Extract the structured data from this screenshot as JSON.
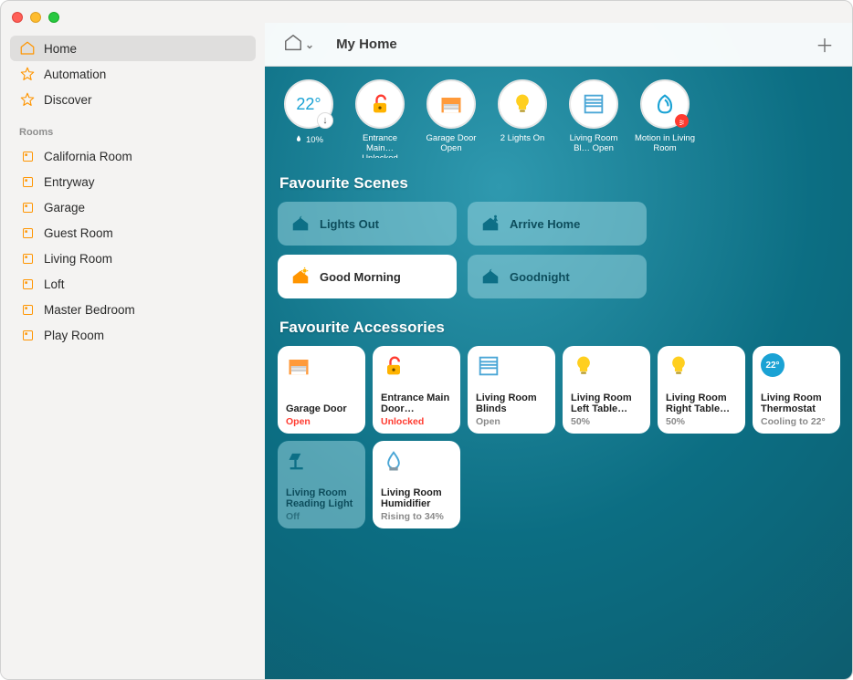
{
  "colors": {
    "accent_orange": "#ff9500",
    "accent_blue": "#1aa2d4",
    "state_red": "#ff3b30"
  },
  "window_title": "My Home",
  "sidebar": {
    "nav": [
      {
        "label": "Home",
        "icon": "home-icon",
        "selected": true
      },
      {
        "label": "Automation",
        "icon": "automation-icon",
        "selected": false
      },
      {
        "label": "Discover",
        "icon": "discover-icon",
        "selected": false
      }
    ],
    "rooms_header": "Rooms",
    "rooms": [
      {
        "label": "California Room"
      },
      {
        "label": "Entryway"
      },
      {
        "label": "Garage"
      },
      {
        "label": "Guest Room"
      },
      {
        "label": "Living Room"
      },
      {
        "label": "Loft"
      },
      {
        "label": "Master Bedroom"
      },
      {
        "label": "Play Room"
      }
    ]
  },
  "status_row": {
    "temp": {
      "value": "22°",
      "humidity": "10%"
    },
    "chips": [
      {
        "label": "Entrance Main… Unlocked",
        "icon": "lock-open-icon"
      },
      {
        "label": "Garage Door Open",
        "icon": "garage-icon"
      },
      {
        "label": "2 Lights On",
        "icon": "bulb-icon"
      },
      {
        "label": "Living Room Bl… Open",
        "icon": "blinds-icon"
      },
      {
        "label": "Motion in Living Room",
        "icon": "motion-icon"
      }
    ]
  },
  "sections": {
    "scenes_title": "Favourite Scenes",
    "accessories_title": "Favourite Accessories"
  },
  "scenes": [
    {
      "label": "Lights Out",
      "style": "dim",
      "icon": "moon-house-icon"
    },
    {
      "label": "Arrive Home",
      "style": "dim",
      "icon": "person-house-icon"
    },
    {
      "label": "Good Morning",
      "style": "bright",
      "icon": "sun-house-icon"
    },
    {
      "label": "Goodnight",
      "style": "dim",
      "icon": "moon-house-icon"
    }
  ],
  "accessories": [
    {
      "name": "Garage Door",
      "state": "Open",
      "state_class": "state-red",
      "icon": "garage-icon",
      "style": "active"
    },
    {
      "name": "Entrance Main Door…",
      "state": "Unlocked",
      "state_class": "state-red",
      "icon": "lock-open-icon",
      "style": "active"
    },
    {
      "name": "Living Room Blinds",
      "state": "Open",
      "state_class": "state-grey",
      "icon": "blinds-icon",
      "style": "active"
    },
    {
      "name": "Living Room Left Table…",
      "state": "50%",
      "state_class": "state-grey",
      "icon": "bulb-icon",
      "style": "active"
    },
    {
      "name": "Living Room Right Table…",
      "state": "50%",
      "state_class": "state-grey",
      "icon": "bulb-icon",
      "style": "active"
    },
    {
      "name": "Living Room Thermostat",
      "state": "Cooling to 22°",
      "state_class": "state-grey",
      "icon": "thermostat-icon",
      "style": "active",
      "badge": "22°"
    },
    {
      "name": "Living Room Reading Light",
      "state": "Off",
      "state_class": "",
      "icon": "lamp-icon",
      "style": "inactive"
    },
    {
      "name": "Living Room Humidifier",
      "state": "Rising to 34%",
      "state_class": "state-grey",
      "icon": "humidifier-icon",
      "style": "active"
    }
  ]
}
